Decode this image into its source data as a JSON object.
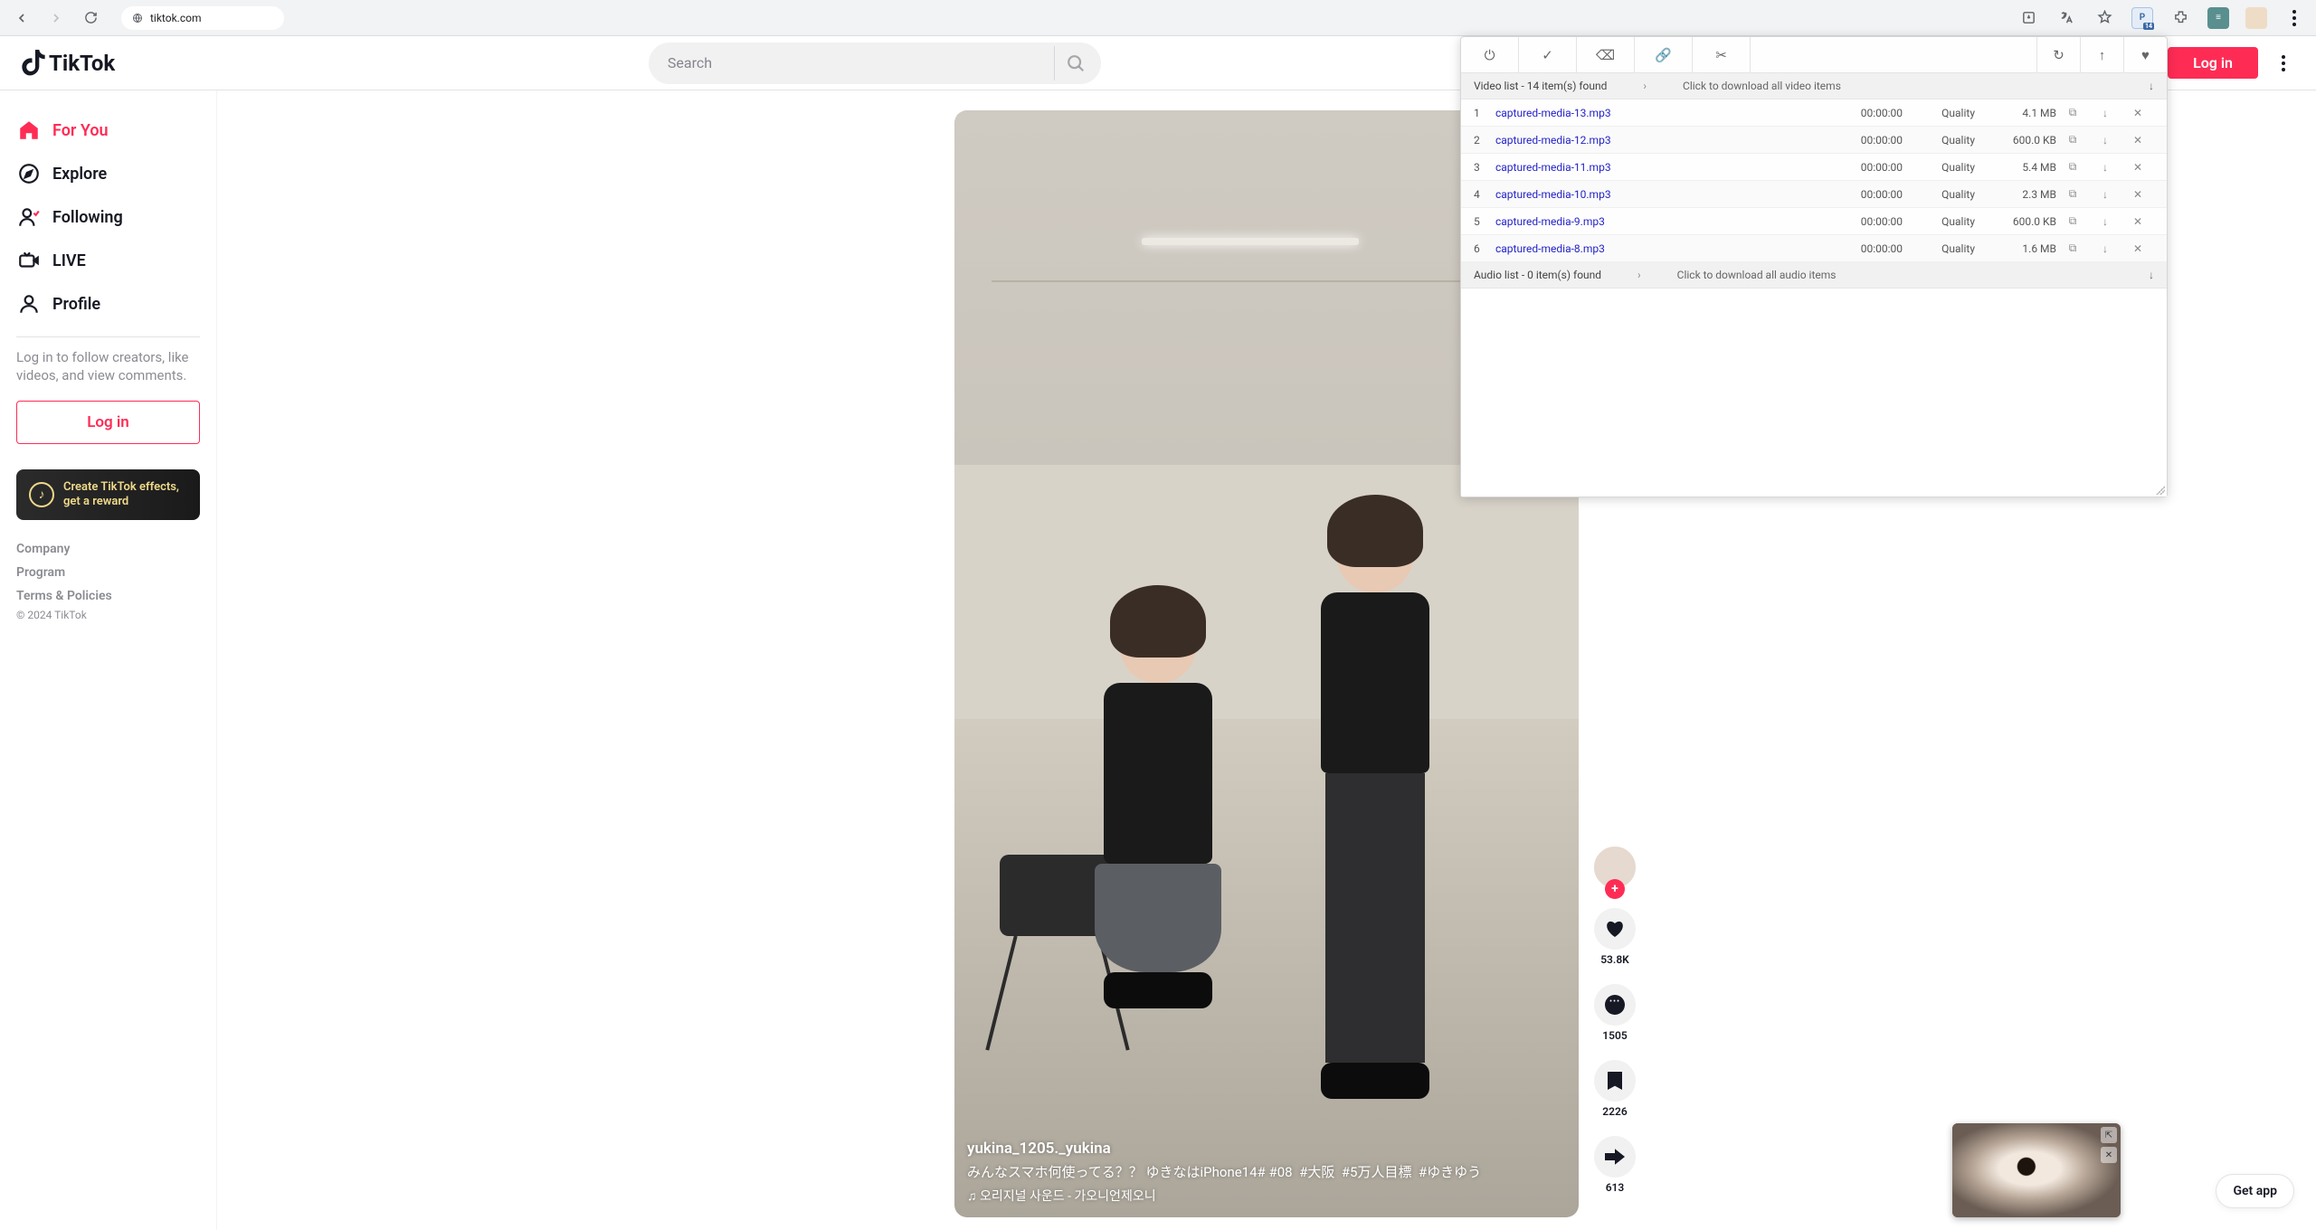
{
  "browser": {
    "url": "tiktok.com"
  },
  "header": {
    "logo_text": "TikTok",
    "search_placeholder": "Search",
    "login_label": "Log in"
  },
  "sidebar": {
    "items": [
      {
        "label": "For You",
        "active": true
      },
      {
        "label": "Explore"
      },
      {
        "label": "Following"
      },
      {
        "label": "LIVE"
      },
      {
        "label": "Profile"
      }
    ],
    "login_prompt": "Log in to follow creators, like videos, and view comments.",
    "login_button": "Log in",
    "effects_banner": "Create TikTok effects, get a reward",
    "footer": [
      "Company",
      "Program",
      "Terms & Policies"
    ],
    "copyright": "© 2024 TikTok"
  },
  "video": {
    "username": "yukina_1205._yukina",
    "caption_text": "みんなスマホ何使ってる？？ ゆきなはiPhone14# ",
    "hashtags": [
      "#08",
      "#大阪",
      "#5万人目標",
      "#ゆきゆう"
    ],
    "sound": "♫ 오리지널 사운드 - 가오니언제오니",
    "actions": {
      "likes": "53.8K",
      "comments": "1505",
      "bookmarks": "2226",
      "shares": "613"
    }
  },
  "downloader": {
    "video_header": "Video list - 14 item(s) found",
    "video_hint": "Click to download all video items",
    "audio_header": "Audio list - 0 item(s) found",
    "audio_hint": "Click to download all audio items",
    "columns_quality": "Quality",
    "items": [
      {
        "idx": "1",
        "name": "captured-media-13.mp3",
        "duration": "00:00:00",
        "quality": "Quality",
        "size": "4.1 MB"
      },
      {
        "idx": "2",
        "name": "captured-media-12.mp3",
        "duration": "00:00:00",
        "quality": "Quality",
        "size": "600.0 KB"
      },
      {
        "idx": "3",
        "name": "captured-media-11.mp3",
        "duration": "00:00:00",
        "quality": "Quality",
        "size": "5.4 MB"
      },
      {
        "idx": "4",
        "name": "captured-media-10.mp3",
        "duration": "00:00:00",
        "quality": "Quality",
        "size": "2.3 MB"
      },
      {
        "idx": "5",
        "name": "captured-media-9.mp3",
        "duration": "00:00:00",
        "quality": "Quality",
        "size": "600.0 KB"
      },
      {
        "idx": "6",
        "name": "captured-media-8.mp3",
        "duration": "00:00:00",
        "quality": "Quality",
        "size": "1.6 MB"
      }
    ]
  },
  "get_app": "Get app"
}
